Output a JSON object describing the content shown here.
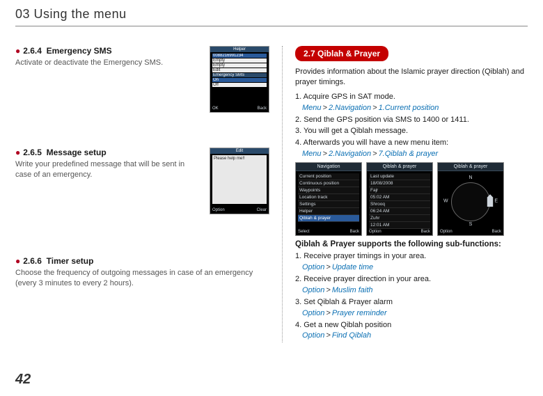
{
  "chapter_title": "03 Using the menu",
  "page_number": "42",
  "left": {
    "s1": {
      "num": "2.6.4",
      "title": "Emergency SMS",
      "body": "Activate or deactivate the Emergency SMS.",
      "thumb": {
        "title": "Helper",
        "rows": [
          "0088216991234",
          "Empty",
          "Empty",
          "Edit",
          "Emergency SMS"
        ],
        "sub": [
          "On",
          "Off"
        ],
        "soft_l": "OK",
        "soft_r": "Back"
      }
    },
    "s2": {
      "num": "2.6.5",
      "title": "Message setup",
      "body": "Write your predefined message that will be sent in case of an emergency.",
      "thumb": {
        "title": "Edit",
        "line": "Please help me!!",
        "soft_l": "Option",
        "soft_r": "Clear"
      }
    },
    "s3": {
      "num": "2.6.6",
      "title": "Timer setup",
      "body": "Choose the frequency of outgoing messages in case of an emergency (every 3 minutes to every 2 hours)."
    }
  },
  "right": {
    "banner": "2.7  Qiblah & Prayer",
    "intro": "Provides information about the Islamic prayer direction (Qiblah) and prayer timings.",
    "steps": [
      {
        "n": "1.",
        "t": "Acquire GPS in SAT mode.",
        "path": [
          "Menu",
          "2.Navigation",
          "1.Current position"
        ]
      },
      {
        "n": "2.",
        "t": "Send the GPS position via SMS to 1400 or 1411."
      },
      {
        "n": "3.",
        "t": "You will get a Qiblah message."
      },
      {
        "n": "4.",
        "t": "Afterwards you will have a new menu item:",
        "path": [
          "Menu",
          "2.Navigation",
          "7.Qiblah & prayer"
        ]
      }
    ],
    "mini": [
      {
        "title": "Navigation",
        "rows": [
          "Current position",
          "Continuous position",
          "Waypoints",
          "Location track",
          "Settings",
          "Helper",
          "Qiblah & prayer"
        ],
        "sel": 6,
        "soft_l": "Select",
        "soft_r": "Back"
      },
      {
        "title": "Qiblah & prayer",
        "rows": [
          "Last update",
          "      18/08/2008",
          "Fajr",
          "      05:02 AM",
          "Shrooq",
          "      06:24 AM",
          "Zuhr",
          "      12:01 AM"
        ],
        "soft_l": "Option",
        "soft_r": "Back"
      },
      {
        "title": "Qiblah & prayer",
        "compass": true,
        "n": "N",
        "s": "S",
        "e": "E",
        "w": "W",
        "soft_l": "Option",
        "soft_r": "Back"
      }
    ],
    "subhead": "Qiblah & Prayer supports the following sub-functions:",
    "funcs": [
      {
        "n": "1.",
        "t": "Receive prayer timings in your area.",
        "path": [
          "Option",
          "Update time"
        ]
      },
      {
        "n": "2.",
        "t": "Receive prayer direction in your area.",
        "path": [
          "Option",
          "Muslim faith"
        ]
      },
      {
        "n": "3.",
        "t": "Set Qiblah & Prayer alarm",
        "path": [
          "Option",
          "Prayer reminder"
        ]
      },
      {
        "n": "4.",
        "t": "Get a new Qiblah position",
        "path": [
          "Option",
          "Find Qiblah"
        ]
      }
    ]
  }
}
